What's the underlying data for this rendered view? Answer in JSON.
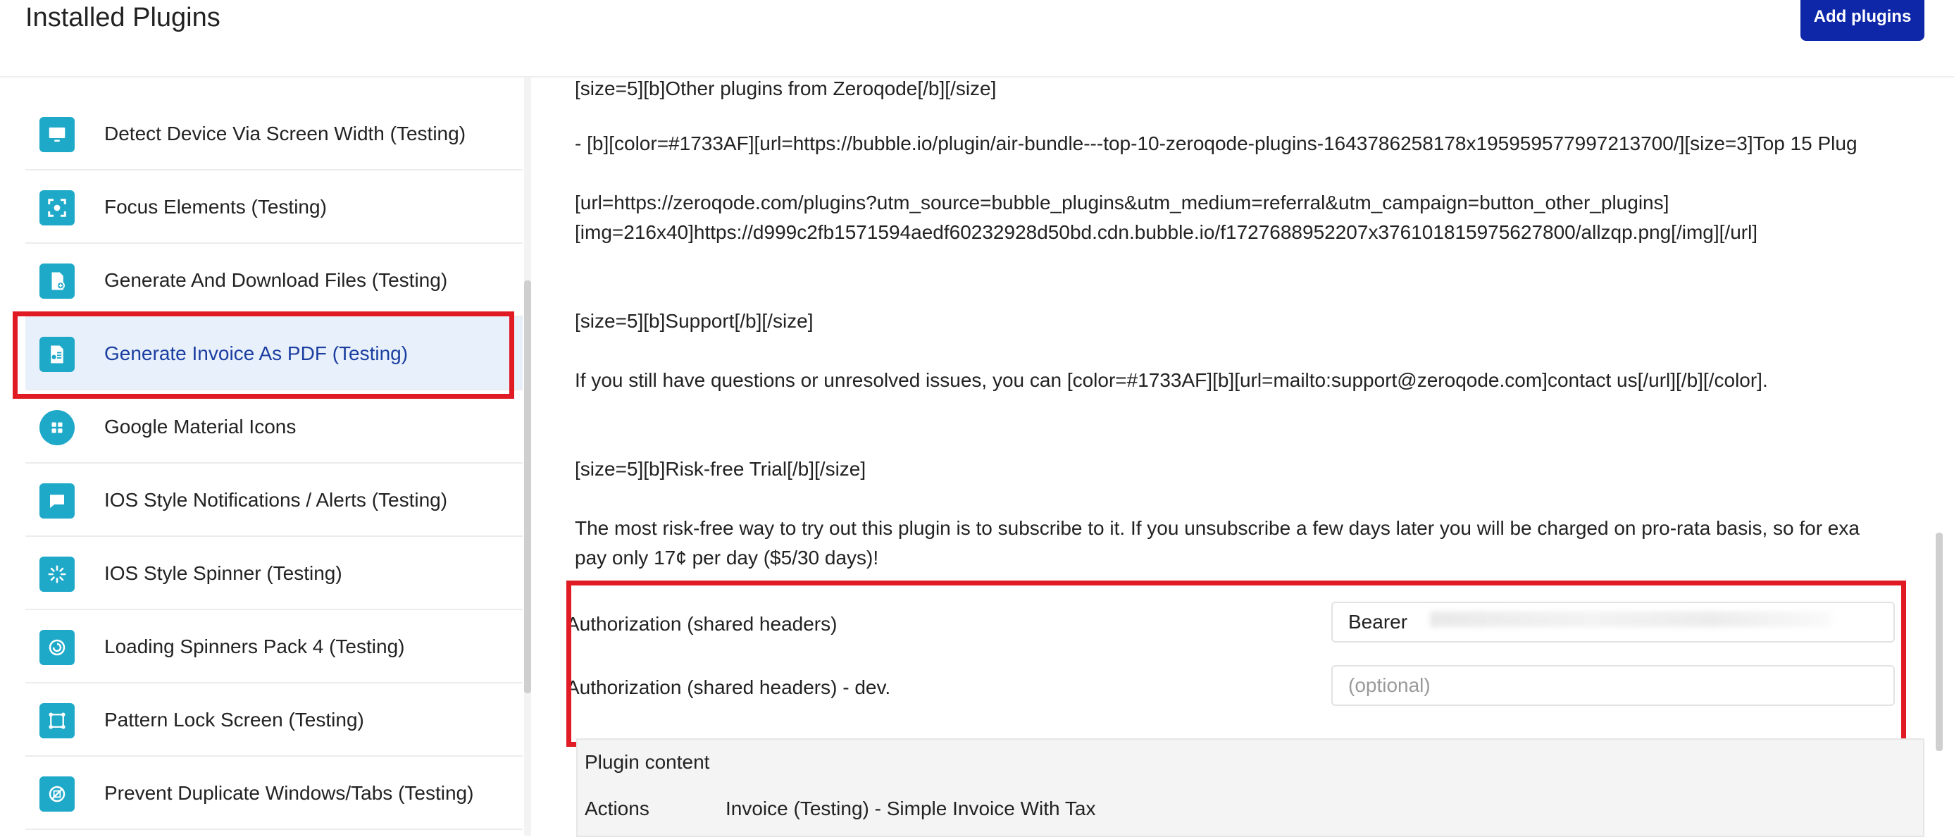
{
  "header": {
    "title": "Installed Plugins",
    "add_button": "Add plugins"
  },
  "sidebar": {
    "items": [
      {
        "label": "Detect Device Via Screen Width (Testing)",
        "icon": "monitor-icon"
      },
      {
        "label": "Focus Elements (Testing)",
        "icon": "focus-icon"
      },
      {
        "label": "Generate And Download Files (Testing)",
        "icon": "file-download-icon"
      },
      {
        "label": "Generate Invoice As PDF (Testing)",
        "icon": "invoice-icon"
      },
      {
        "label": "Google Material Icons",
        "icon": "grid-icon"
      },
      {
        "label": "IOS Style Notifications / Alerts (Testing)",
        "icon": "chat-bubble-icon"
      },
      {
        "label": "IOS Style Spinner (Testing)",
        "icon": "spinner-icon"
      },
      {
        "label": "Loading Spinners Pack 4 (Testing)",
        "icon": "refresh-icon"
      },
      {
        "label": "Pattern Lock Screen (Testing)",
        "icon": "pattern-icon"
      },
      {
        "label": "Prevent Duplicate Windows/Tabs (Testing)",
        "icon": "no-duplicate-icon"
      }
    ]
  },
  "description": {
    "line1": "[size=5][b]Other plugins from Zeroqode[/b][/size]",
    "line2": "- [b][color=#1733AF][url=https://bubble.io/plugin/air-bundle---top-10-zeroqode-plugins-1643786258178x195959577997213700/][size=3]Top 15 Plug",
    "line3": "[url=https://zeroqode.com/plugins?utm_source=bubble_plugins&utm_medium=referral&utm_campaign=button_other_plugins]",
    "line4": "[img=216x40]https://d999c2fb1571594aedf60232928d50bd.cdn.bubble.io/f1727688952207x376101815975627800/allzqp.png[/img][/url]",
    "line5": "[size=5][b]Support[/b][/size]",
    "line6": "If you still have questions or unresolved issues, you can [color=#1733AF][b][url=mailto:support@zeroqode.com]contact us[/url][/b][/color].",
    "line7": "[size=5][b]Risk-free Trial[/b][/size]",
    "line8": "The most risk-free way to try out this plugin is to subscribe to it. If you unsubscribe a few days later you will be charged on pro-rata basis, so for exa",
    "line9": "pay only 17¢ per day ($5/30 days)!"
  },
  "settings": {
    "auth_label": "Authorization (shared headers)",
    "auth_value": "Bearer",
    "auth_dev_label": "Authorization (shared headers) - dev.",
    "auth_dev_placeholder": "(optional)"
  },
  "plugin_content": {
    "title": "Plugin content",
    "actions_label": "Actions",
    "actions_value": "Invoice (Testing) - Simple Invoice With Tax"
  },
  "colors": {
    "accent": "#0d27a8",
    "icon_bg": "#1fa9c9",
    "highlight": "#e01b24",
    "selected_bg": "#e8f0fb"
  }
}
